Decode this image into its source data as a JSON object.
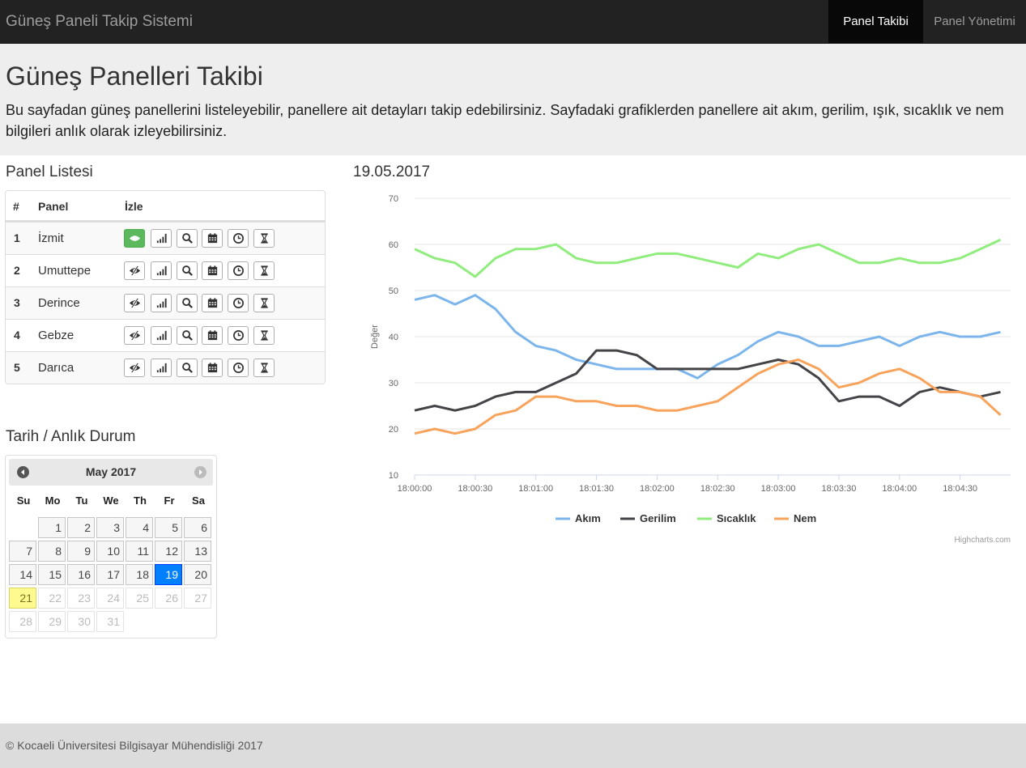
{
  "navbar": {
    "brand": "Güneş Paneli Takip Sistemi",
    "items": [
      {
        "label": "Panel Takibi",
        "active": true
      },
      {
        "label": "Panel Yönetimi",
        "active": false
      }
    ]
  },
  "jumbotron": {
    "title": "Güneş Panelleri Takibi",
    "text": "Bu sayfadan güneş panellerini listeleyebilir, panellere ait detayları takip edebilirsiniz. Sayfadaki grafiklerden panellere ait akım, gerilim, ışık, sıcaklık ve nem bilgileri anlık olarak izleyebilirsiniz."
  },
  "panel_list": {
    "title": "Panel Listesi",
    "headers": [
      "#",
      "Panel",
      "İzle"
    ],
    "rows": [
      {
        "num": "1",
        "name": "İzmit",
        "watching": true
      },
      {
        "num": "2",
        "name": "Umuttepe",
        "watching": false
      },
      {
        "num": "3",
        "name": "Derince",
        "watching": false
      },
      {
        "num": "4",
        "name": "Gebze",
        "watching": false
      },
      {
        "num": "5",
        "name": "Darıca",
        "watching": false
      }
    ],
    "action_icons": [
      "eye-icon",
      "signal-icon",
      "search-icon",
      "calendar-icon",
      "clock-icon",
      "hourglass-icon"
    ]
  },
  "calendar": {
    "section_title": "Tarih / Anlık Durum",
    "month_title": "May 2017",
    "weekdays": [
      "Su",
      "Mo",
      "Tu",
      "We",
      "Th",
      "Fr",
      "Sa"
    ],
    "days": [
      "1",
      "2",
      "3",
      "4",
      "5",
      "6",
      "7",
      "8",
      "9",
      "10",
      "11",
      "12",
      "13",
      "14",
      "15",
      "16",
      "17",
      "18",
      "19",
      "20",
      "21",
      "22",
      "23",
      "24",
      "25",
      "26",
      "27",
      "28",
      "29",
      "30",
      "31"
    ],
    "selected_day": "19",
    "today": "21",
    "prev_icon": "circle-arrow-left-icon",
    "next_icon": "circle-arrow-right-icon"
  },
  "chart_title": "19.05.2017",
  "chart_data": {
    "type": "line",
    "ylabel": "Değer",
    "xlabel": "",
    "ylim": [
      10,
      70
    ],
    "yticks": [
      "10",
      "20",
      "30",
      "40",
      "50",
      "60",
      "70"
    ],
    "xticks": [
      "18:00:00",
      "18:00:30",
      "18:01:00",
      "18:01:30",
      "18:02:00",
      "18:02:30",
      "18:03:00",
      "18:03:30",
      "18:04:00",
      "18:04:30"
    ],
    "x_seconds": [
      0,
      10,
      20,
      30,
      40,
      50,
      60,
      70,
      80,
      90,
      100,
      110,
      120,
      130,
      140,
      150,
      160,
      170,
      180,
      190,
      200,
      210,
      220,
      230,
      240,
      250,
      260,
      270,
      280,
      290
    ],
    "series": [
      {
        "name": "Akım",
        "color": "#7cb5ec",
        "values": [
          48,
          49,
          47,
          49,
          46,
          41,
          38,
          37,
          35,
          34,
          33,
          33,
          33,
          33,
          31,
          34,
          36,
          39,
          41,
          40,
          38,
          38,
          39,
          40,
          38,
          40,
          41,
          40,
          40,
          41
        ]
      },
      {
        "name": "Gerilim",
        "color": "#434348",
        "values": [
          24,
          25,
          24,
          25,
          27,
          28,
          28,
          30,
          32,
          37,
          37,
          36,
          33,
          33,
          33,
          33,
          33,
          34,
          35,
          34,
          31,
          26,
          27,
          27,
          25,
          28,
          29,
          28,
          27,
          28
        ]
      },
      {
        "name": "Sıcaklık",
        "color": "#90ed7d",
        "values": [
          59,
          57,
          56,
          53,
          57,
          59,
          59,
          60,
          57,
          56,
          56,
          57,
          58,
          58,
          57,
          56,
          55,
          58,
          57,
          59,
          60,
          58,
          56,
          56,
          57,
          56,
          56,
          57,
          59,
          61
        ]
      },
      {
        "name": "Nem",
        "color": "#f7a35c",
        "values": [
          19,
          20,
          19,
          20,
          23,
          24,
          27,
          27,
          26,
          26,
          25,
          25,
          24,
          24,
          25,
          26,
          29,
          32,
          34,
          35,
          33,
          29,
          30,
          32,
          33,
          31,
          28,
          28,
          27,
          23
        ]
      }
    ],
    "legend_position": "bottom",
    "grid": true,
    "credits": "Highcharts.com"
  },
  "footer": {
    "text": "© Kocaeli Üniversitesi Bilgisayar Mühendisliği 2017"
  }
}
